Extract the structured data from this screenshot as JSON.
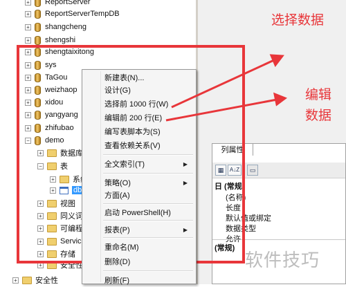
{
  "tree": {
    "items": [
      {
        "label": "ReportServer",
        "kind": "db"
      },
      {
        "label": "ReportServerTempDB",
        "kind": "db"
      },
      {
        "label": "shangcheng",
        "kind": "db"
      },
      {
        "label": "shengshi",
        "kind": "db"
      },
      {
        "label": "shengtaixitong",
        "kind": "db"
      },
      {
        "label": "sys",
        "kind": "db"
      },
      {
        "label": "TaGou",
        "kind": "db"
      },
      {
        "label": "weizhaop",
        "kind": "db"
      },
      {
        "label": "xidou",
        "kind": "db"
      },
      {
        "label": "yangyang",
        "kind": "db"
      },
      {
        "label": "zhifubao",
        "kind": "db"
      },
      {
        "label": "demo",
        "kind": "db",
        "expanded": true
      },
      {
        "label": "数据库",
        "kind": "folder"
      },
      {
        "label": "表",
        "kind": "folder",
        "expanded": true
      },
      {
        "label": "系统",
        "kind": "folder"
      },
      {
        "label": "db",
        "kind": "table",
        "selected": true
      },
      {
        "label": "视图",
        "kind": "folder"
      },
      {
        "label": "同义词",
        "kind": "folder"
      },
      {
        "label": "可编程",
        "kind": "folder"
      },
      {
        "label": "Servic",
        "kind": "folder"
      },
      {
        "label": "存储",
        "kind": "folder"
      },
      {
        "label": "安全性",
        "kind": "folder"
      },
      {
        "label": "安全性",
        "kind": "folder"
      }
    ]
  },
  "context_menu": {
    "items": [
      {
        "label": "新建表(N)...",
        "submenu": false
      },
      {
        "label": "设计(G)",
        "submenu": false
      },
      {
        "label": "选择前 1000 行(W)",
        "submenu": false
      },
      {
        "label": "编辑前 200 行(E)",
        "submenu": false
      },
      {
        "label": "编写表脚本为(S)",
        "submenu": false
      },
      {
        "label": "查看依赖关系(V)",
        "submenu": false
      },
      {
        "label": "全文索引(T)",
        "submenu": true
      },
      {
        "label": "策略(O)",
        "submenu": true
      },
      {
        "label": "方面(A)",
        "submenu": false
      },
      {
        "label": "启动 PowerShell(H)",
        "submenu": false
      },
      {
        "label": "报表(P)",
        "submenu": true
      },
      {
        "label": "重命名(M)",
        "submenu": false
      },
      {
        "label": "删除(D)",
        "submenu": false
      },
      {
        "label": "刷新(F)",
        "submenu": false
      }
    ]
  },
  "properties": {
    "tab_label": "列属性",
    "toolbar": {
      "az_label": "A↓Z"
    },
    "rows": [
      {
        "label": "日 (常规",
        "bold": true
      },
      {
        "label": "(名称)",
        "bold": false
      },
      {
        "label": "长度",
        "bold": false
      },
      {
        "label": "默认值或绑定",
        "bold": false
      },
      {
        "label": "数据类型",
        "bold": false
      },
      {
        "label": "允许",
        "bold": false
      }
    ],
    "description_label": "(常规)"
  },
  "annotations": {
    "select_data": "选择数据",
    "edit_data_line1": "编辑",
    "edit_data_line2": "数据",
    "accent_color": "#e8363a"
  },
  "watermark": "软件技巧"
}
